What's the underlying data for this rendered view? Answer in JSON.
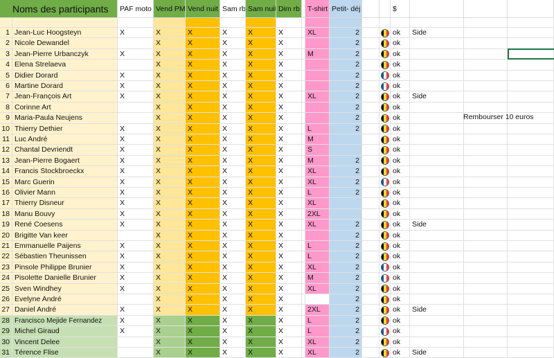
{
  "headers": {
    "name": "Noms des participants",
    "paf": "PAF moto",
    "vpm": "Vend PM",
    "vnuit": "Vend nuit",
    "samrb": "Sam rb",
    "samnuit": "Sam nuit",
    "dimrb": "Dim rb",
    "tshirt": "T-shirt",
    "petit": "Petit- déj",
    "dollar": "$"
  },
  "note": "Rembourser 10 euros",
  "colors": {
    "header_green": "#70ad47",
    "name_peach": "#fff2cc",
    "name_green": "#c6e0b4",
    "vpm_peach": "#ffe699",
    "vpm_green": "#a9d08e",
    "vnuit_orange": "#ffc000",
    "vnuit_green": "#70ad47",
    "tshirt_pink": "#ff99cc",
    "petit_blue": "#bdd7ee",
    "flag_be": [
      "#000000",
      "#fdda24",
      "#ef3340"
    ],
    "flag_fr": [
      "#0055a4",
      "#ffffff",
      "#ef4135"
    ]
  },
  "rows": [
    {
      "n": "1",
      "name": "Jean-Luc Hoogsteyn",
      "paf": "X",
      "vpm": "X",
      "vnuit": "X",
      "samrb": "X",
      "samnuit": "X",
      "dimrb": "X",
      "tshirt": "XL",
      "petit": "2",
      "flag": "be",
      "ok": "ok",
      "extra": "Side"
    },
    {
      "n": "2",
      "name": "Nicole Dewandel",
      "paf": "",
      "vpm": "X",
      "vnuit": "X",
      "samrb": "X",
      "samnuit": "X",
      "dimrb": "X",
      "tshirt": "",
      "petit": "2",
      "flag": "be",
      "ok": "ok",
      "extra": ""
    },
    {
      "n": "3",
      "name": "Jean-Pierre Urbanczyk",
      "paf": "X",
      "vpm": "X",
      "vnuit": "X",
      "samrb": "X",
      "samnuit": "X",
      "dimrb": "X",
      "tshirt": "M",
      "petit": "2",
      "flag": "be",
      "ok": "ok",
      "extra": ""
    },
    {
      "n": "4",
      "name": "Elena Strelaeva",
      "paf": "",
      "vpm": "X",
      "vnuit": "X",
      "samrb": "X",
      "samnuit": "X",
      "dimrb": "X",
      "tshirt": "",
      "petit": "2",
      "flag": "be",
      "ok": "ok",
      "extra": ""
    },
    {
      "n": "5",
      "name": "Didier Dorard",
      "paf": "X",
      "vpm": "X",
      "vnuit": "X",
      "samrb": "X",
      "samnuit": "X",
      "dimrb": "X",
      "tshirt": "",
      "petit": "2",
      "flag": "fr",
      "ok": "ok",
      "extra": ""
    },
    {
      "n": "6",
      "name": "Martine Dorard",
      "paf": "X",
      "vpm": "X",
      "vnuit": "X",
      "samrb": "X",
      "samnuit": "X",
      "dimrb": "X",
      "tshirt": "",
      "petit": "2",
      "flag": "fr",
      "ok": "ok",
      "extra": ""
    },
    {
      "n": "7",
      "name": "Jean-François Art",
      "paf": "X",
      "vpm": "X",
      "vnuit": "X",
      "samrb": "X",
      "samnuit": "X",
      "dimrb": "X",
      "tshirt": "XL",
      "petit": "2",
      "flag": "be",
      "ok": "ok",
      "extra": "Side"
    },
    {
      "n": "8",
      "name": "Corinne Art",
      "paf": "",
      "vpm": "X",
      "vnuit": "X",
      "samrb": "X",
      "samnuit": "X",
      "dimrb": "X",
      "tshirt": "",
      "petit": "2",
      "flag": "be",
      "ok": "ok",
      "extra": ""
    },
    {
      "n": "9",
      "name": "Maria-Paula Neujens",
      "paf": "",
      "vpm": "X",
      "vnuit": "X",
      "samrb": "X",
      "samnuit": "X",
      "dimrb": "X",
      "tshirt": "",
      "petit": "2",
      "flag": "be",
      "ok": "ok",
      "extra": ""
    },
    {
      "n": "10",
      "name": "Thierry Dethier",
      "paf": "X",
      "vpm": "X",
      "vnuit": "X",
      "samrb": "X",
      "samnuit": "X",
      "dimrb": "X",
      "tshirt": "L",
      "petit": "2",
      "flag": "be",
      "ok": "ok",
      "extra": ""
    },
    {
      "n": "11",
      "name": "Luc André",
      "paf": "X",
      "vpm": "X",
      "vnuit": "X",
      "samrb": "X",
      "samnuit": "X",
      "dimrb": "X",
      "tshirt": "M",
      "petit": "",
      "flag": "be",
      "ok": "ok",
      "extra": ""
    },
    {
      "n": "12",
      "name": "Chantal Devriendt",
      "paf": "X",
      "vpm": "X",
      "vnuit": "X",
      "samrb": "X",
      "samnuit": "X",
      "dimrb": "X",
      "tshirt": "S",
      "petit": "",
      "flag": "be",
      "ok": "ok",
      "extra": ""
    },
    {
      "n": "13",
      "name": "Jean-Pierre Bogaert",
      "paf": "X",
      "vpm": "X",
      "vnuit": "X",
      "samrb": "X",
      "samnuit": "X",
      "dimrb": "X",
      "tshirt": "M",
      "petit": "2",
      "flag": "be",
      "ok": "ok",
      "extra": ""
    },
    {
      "n": "14",
      "name": "Francis Stockbroeckx",
      "paf": "X",
      "vpm": "X",
      "vnuit": "X",
      "samrb": "X",
      "samnuit": "X",
      "dimrb": "X",
      "tshirt": "XL",
      "petit": "2",
      "flag": "be",
      "ok": "ok",
      "extra": ""
    },
    {
      "n": "15",
      "name": "Marc Guerin",
      "paf": "X",
      "vpm": "X",
      "vnuit": "X",
      "samrb": "X",
      "samnuit": "X",
      "dimrb": "X",
      "tshirt": "XL",
      "petit": "2",
      "flag": "fr",
      "ok": "ok",
      "extra": ""
    },
    {
      "n": "16",
      "name": "Olivier Mann",
      "paf": "X",
      "vpm": "X",
      "vnuit": "X",
      "samrb": "X",
      "samnuit": "X",
      "dimrb": "X",
      "tshirt": "L",
      "petit": "2",
      "flag": "be",
      "ok": "ok",
      "extra": ""
    },
    {
      "n": "17",
      "name": "Thierry Disneur",
      "paf": "X",
      "vpm": "X",
      "vnuit": "X",
      "samrb": "X",
      "samnuit": "X",
      "dimrb": "X",
      "tshirt": "XL",
      "petit": "",
      "flag": "be",
      "ok": "ok",
      "extra": ""
    },
    {
      "n": "18",
      "name": "Manu Bouvy",
      "paf": "X",
      "vpm": "X",
      "vnuit": "X",
      "samrb": "X",
      "samnuit": "X",
      "dimrb": "X",
      "tshirt": "2XL",
      "petit": "",
      "flag": "be",
      "ok": "ok",
      "extra": ""
    },
    {
      "n": "19",
      "name": "René Coesens",
      "paf": "X",
      "vpm": "X",
      "vnuit": "X",
      "samrb": "X",
      "samnuit": "X",
      "dimrb": "X",
      "tshirt": "XL",
      "petit": "2",
      "flag": "be",
      "ok": "ok",
      "extra": "Side"
    },
    {
      "n": "20",
      "name": "Brigitte Van keer",
      "paf": "",
      "vpm": "X",
      "vnuit": "X",
      "samrb": "X",
      "samnuit": "X",
      "dimrb": "X",
      "tshirt": "",
      "petit": "2",
      "flag": "be",
      "ok": "ok",
      "extra": ""
    },
    {
      "n": "21",
      "name": "Emmanuelle Paijens",
      "paf": "X",
      "vpm": "X",
      "vnuit": "X",
      "samrb": "X",
      "samnuit": "X",
      "dimrb": "X",
      "tshirt": "L",
      "petit": "2",
      "flag": "be",
      "ok": "ok",
      "extra": ""
    },
    {
      "n": "22",
      "name": "Sébastien Theunissen",
      "paf": "X",
      "vpm": "X",
      "vnuit": "X",
      "samrb": "X",
      "samnuit": "X",
      "dimrb": "X",
      "tshirt": "L",
      "petit": "2",
      "flag": "be",
      "ok": "ok",
      "extra": ""
    },
    {
      "n": "23",
      "name": "Pinsole Philippe Brunier",
      "paf": "X",
      "vpm": "X",
      "vnuit": "X",
      "samrb": "X",
      "samnuit": "X",
      "dimrb": "X",
      "tshirt": "XL",
      "petit": "2",
      "flag": "fr",
      "ok": "ok",
      "extra": ""
    },
    {
      "n": "24",
      "name": "Pisolette Danielle Brunier",
      "paf": "X",
      "vpm": "X",
      "vnuit": "X",
      "samrb": "X",
      "samnuit": "X",
      "dimrb": "X",
      "tshirt": "M",
      "petit": "2",
      "flag": "fr",
      "ok": "ok",
      "extra": ""
    },
    {
      "n": "25",
      "name": "Sven Windhey",
      "paf": "X",
      "vpm": "X",
      "vnuit": "X",
      "samrb": "X",
      "samnuit": "X",
      "dimrb": "X",
      "tshirt": "XL",
      "petit": "2",
      "flag": "be",
      "ok": "ok",
      "extra": ""
    },
    {
      "n": "26",
      "name": "Evelyne André",
      "paf": "",
      "vpm": "X",
      "vnuit": "X",
      "samrb": "X",
      "samnuit": "X",
      "dimrb": "X",
      "tshirt": "",
      "petit": "2",
      "flag": "be",
      "ok": "ok",
      "extra": ""
    },
    {
      "n": "27",
      "name": "Daniel André",
      "paf": "X",
      "vpm": "X",
      "vnuit": "X",
      "samrb": "X",
      "samnuit": "X",
      "dimrb": "X",
      "tshirt": "2XL",
      "petit": "2",
      "flag": "be",
      "ok": "ok",
      "extra": "Side"
    },
    {
      "n": "28",
      "name": "Francisco Mejide Fernandez",
      "paf": "X",
      "vpm": "X",
      "vnuit": "X",
      "samrb": "X",
      "samnuit": "X",
      "dimrb": "X",
      "tshirt": "L",
      "petit": "2",
      "flag": "be",
      "ok": "ok",
      "extra": ""
    },
    {
      "n": "29",
      "name": "Michel Giraud",
      "paf": "X",
      "vpm": "X",
      "vnuit": "X",
      "samrb": "X",
      "samnuit": "X",
      "dimrb": "X",
      "tshirt": "L",
      "petit": "2",
      "flag": "fr",
      "ok": "ok",
      "extra": ""
    },
    {
      "n": "30",
      "name": "Vincent Delee",
      "paf": "",
      "vpm": "X",
      "vnuit": "X",
      "samrb": "X",
      "samnuit": "X",
      "dimrb": "X",
      "tshirt": "XL",
      "petit": "2",
      "flag": "be",
      "ok": "ok",
      "extra": ""
    },
    {
      "n": "31",
      "name": "Térence Flise",
      "paf": "",
      "vpm": "X",
      "vnuit": "X",
      "samrb": "X",
      "samnuit": "X",
      "dimrb": "X",
      "tshirt": "XL",
      "petit": "2",
      "flag": "be",
      "ok": "ok",
      "extra": "Side"
    }
  ]
}
